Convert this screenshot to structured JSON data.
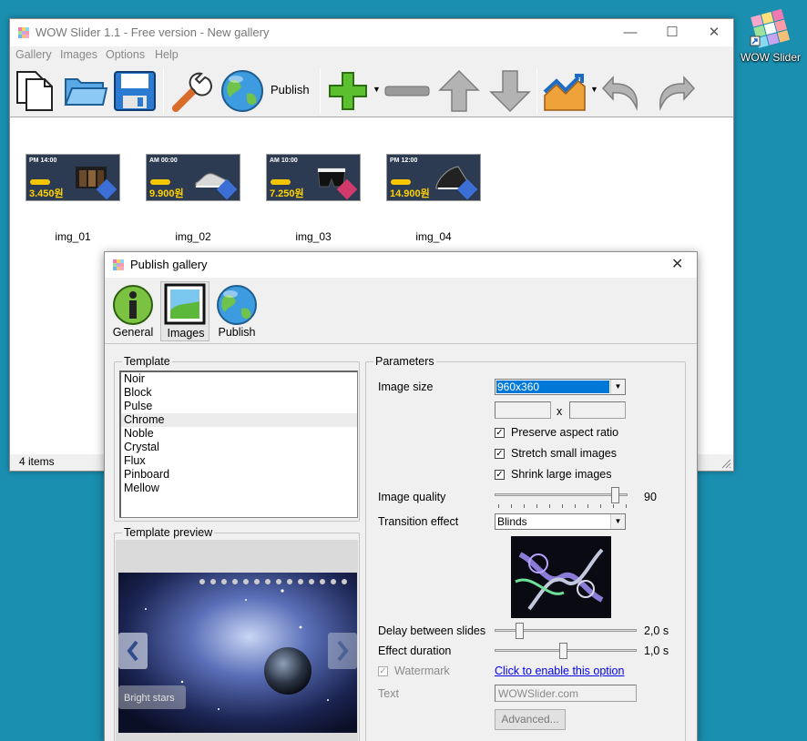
{
  "desktop": {
    "app_label": "WOW Slider"
  },
  "main_window": {
    "title": "WOW Slider 1.1 - Free version - New gallery",
    "menu": [
      "Gallery",
      "Images",
      "Options",
      "Help"
    ],
    "toolbar": {
      "publish_label": "Publish"
    },
    "images": [
      {
        "name": "img_01",
        "time": "PM 14:00",
        "price": "3.450원"
      },
      {
        "name": "img_02",
        "time": "AM 00:00",
        "price": "9.900원"
      },
      {
        "name": "img_03",
        "time": "AM 10:00",
        "price": "7.250원"
      },
      {
        "name": "img_04",
        "time": "PM 12:00",
        "price": "14.900원"
      }
    ],
    "status": "4 items"
  },
  "dialog": {
    "title": "Publish gallery",
    "tabs": [
      "General",
      "Images",
      "Publish"
    ],
    "active_tab": "Images",
    "template_group": "Template",
    "templates": [
      "Noir",
      "Block",
      "Pulse",
      "Chrome",
      "Noble",
      "Crystal",
      "Flux",
      "Pinboard",
      "Mellow"
    ],
    "selected_template": "Chrome",
    "preview_group": "Template preview",
    "preview_caption": "Bright stars",
    "parameters": {
      "group_label": "Parameters",
      "image_size_label": "Image size",
      "image_size_value": "960x360",
      "size_separator": "x",
      "preserve_aspect": "Preserve aspect ratio",
      "stretch_small": "Stretch small images",
      "shrink_large": "Shrink large images",
      "quality_label": "Image quality",
      "quality_value": "90",
      "transition_label": "Transition effect",
      "transition_value": "Blinds",
      "delay_label": "Delay between slides",
      "delay_value": "2,0 s",
      "duration_label": "Effect duration",
      "duration_value": "1,0 s",
      "watermark_label": "Watermark",
      "watermark_link": "Click to enable this option",
      "text_label": "Text",
      "text_value": "WOWSlider.com",
      "advanced_button": "Advanced..."
    }
  },
  "colors": {
    "desktop": "#1a8fb0",
    "selection": "#0078d7",
    "link": "#0000ee"
  }
}
